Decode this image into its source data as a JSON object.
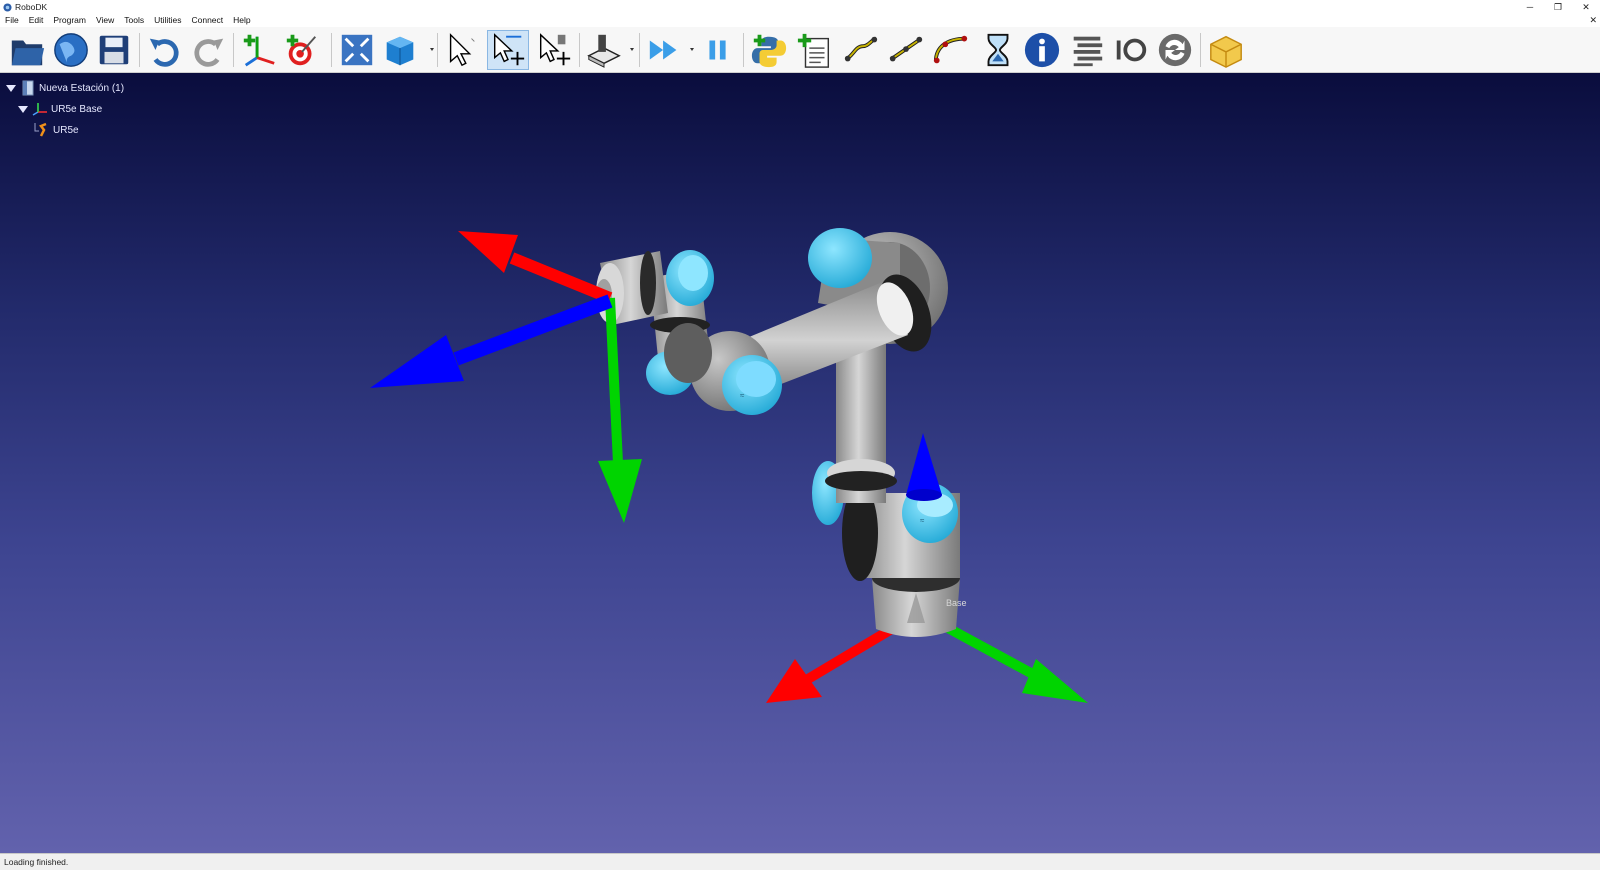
{
  "window": {
    "title": "RoboDK"
  },
  "menu": {
    "items": [
      "File",
      "Edit",
      "Program",
      "View",
      "Tools",
      "Utilities",
      "Connect",
      "Help"
    ]
  },
  "toolbar": {
    "buttons": [
      "open-folder-icon",
      "web-library-icon",
      "save-icon",
      "undo-icon",
      "redo-icon",
      "add-reference-frame-icon",
      "add-target-icon",
      "fit-all-icon",
      "iso-view-cube-icon",
      "select-icon",
      "move-reference-icon",
      "move-tool-icon",
      "cut-object-icon",
      "run-fast-icon",
      "pause-icon",
      "python-program-icon",
      "add-program-icon",
      "move-joint-icon",
      "move-linear-icon",
      "move-circular-icon",
      "pause-instruction-icon",
      "info-icon",
      "set-tool-icon",
      "io-icon",
      "sync-icon",
      "package-icon"
    ],
    "active": "move-reference-icon"
  },
  "tree": {
    "station": "Nueva Estación (1)",
    "base": "UR5e Base",
    "robot": "UR5e"
  },
  "scene": {
    "base_label": "Base"
  },
  "status": {
    "text": "Loading finished."
  },
  "colors": {
    "robot_accent": "#3ec3e8",
    "axis_x": "#ff0000",
    "axis_y": "#00d400",
    "axis_z": "#0000ff"
  }
}
